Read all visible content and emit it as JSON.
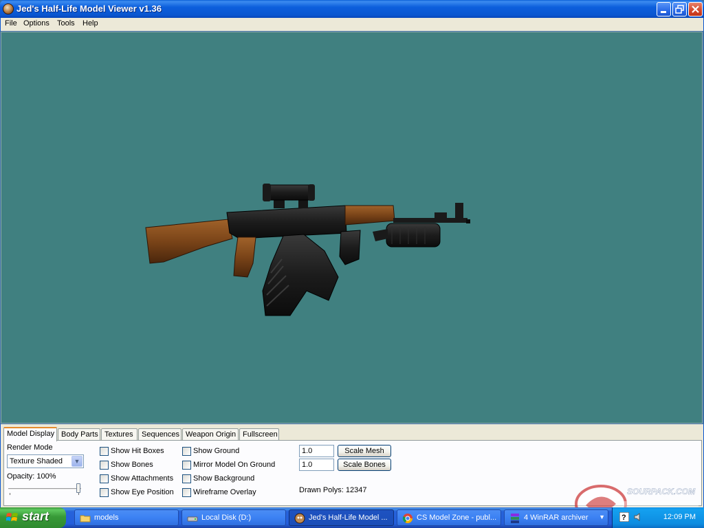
{
  "window": {
    "title": "Jed's Half-Life Model Viewer v1.36"
  },
  "menu": [
    "File",
    "Options",
    "Tools",
    "Help"
  ],
  "tabs": [
    "Model Display",
    "Body Parts",
    "Textures",
    "Sequences",
    "Weapon Origin",
    "Fullscreen"
  ],
  "model_display": {
    "render_mode_label": "Render Mode",
    "render_mode_value": "Texture Shaded",
    "opacity_label": "Opacity: 100%",
    "opacity_value": 1.0,
    "checkboxes_col1": [
      "Show Hit Boxes",
      "Show Bones",
      "Show Attachments",
      "Show Eye Position"
    ],
    "checkboxes_col2": [
      "Show Ground",
      "Mirror Model On Ground",
      "Show Background",
      "Wireframe Overlay"
    ],
    "scale_mesh_value": "1.0",
    "scale_mesh_label": "Scale Mesh",
    "scale_bones_value": "1.0",
    "scale_bones_label": "Scale Bones",
    "drawn_polys": "Drawn Polys: 12347"
  },
  "colors": {
    "viewport_bg": "#408080",
    "titlebar": "#0a56d0",
    "panel_bg": "#ece9d8"
  },
  "taskbar": {
    "start_label": "start",
    "tasks": [
      {
        "label": "models",
        "icon": "folder-icon"
      },
      {
        "label": "Local Disk (D:)",
        "icon": "drive-icon"
      },
      {
        "label": "Jed's Half-Life Model ...",
        "icon": "hl-model-viewer-icon",
        "active": true
      },
      {
        "label": "CS Model Zone - publ...",
        "icon": "chrome-icon"
      },
      {
        "label": "4  WinRAR archiver",
        "icon": "winrar-icon"
      }
    ],
    "clock": "12:09 PM"
  },
  "watermark": {
    "text": "SOURPACK.COM"
  }
}
